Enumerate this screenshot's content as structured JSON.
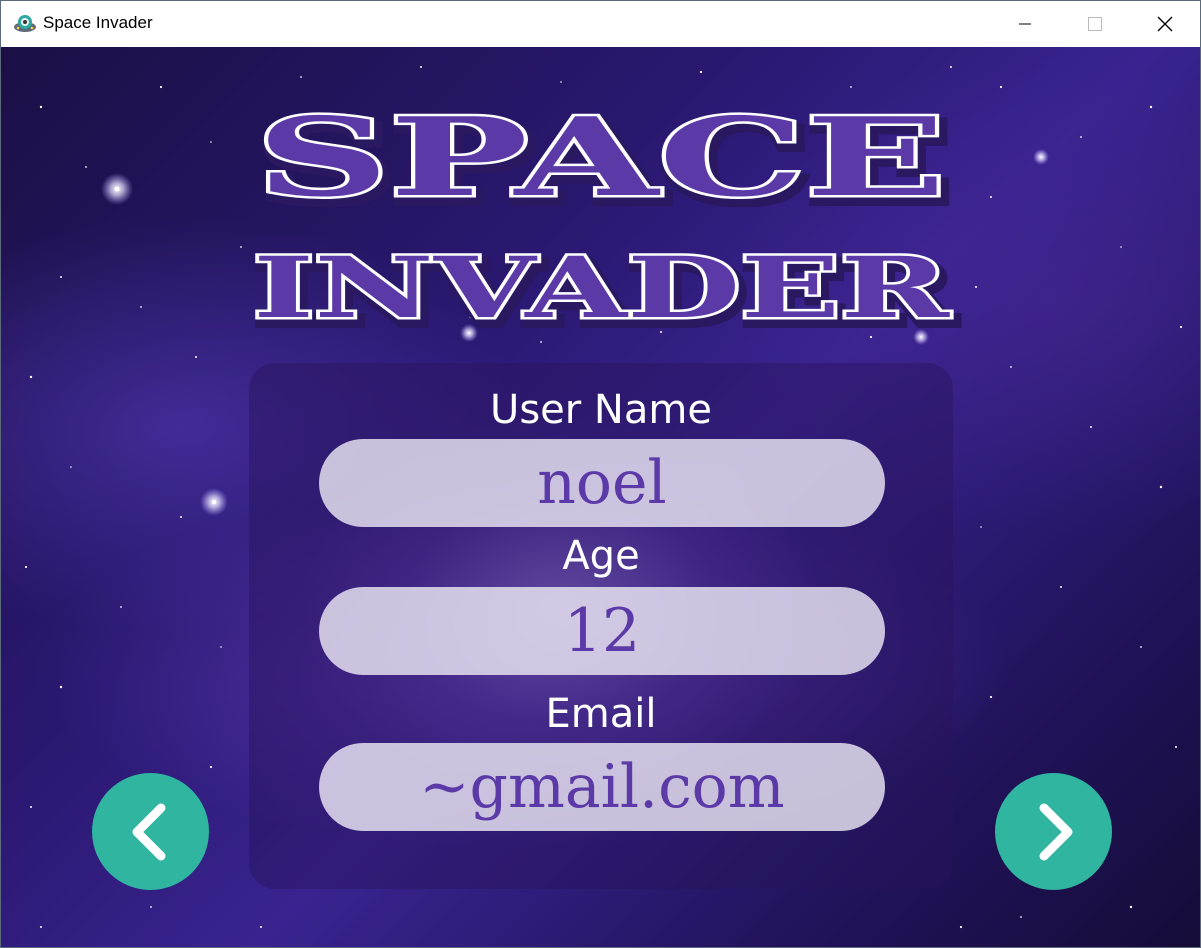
{
  "window": {
    "title": "Space Invader",
    "icon": "alien-ufo-icon"
  },
  "logo": {
    "line1": "SPACE",
    "line2": "INVADER",
    "fill_color": "#5b3aa8"
  },
  "form": {
    "username_label": "User Name",
    "username_value": "noel",
    "age_label": "Age",
    "age_value": "12",
    "email_label": "Email",
    "email_value": "~gmail.com"
  },
  "nav": {
    "back_icon": "chevron-left-icon",
    "next_icon": "chevron-right-icon",
    "button_color": "#2fb5a0"
  }
}
